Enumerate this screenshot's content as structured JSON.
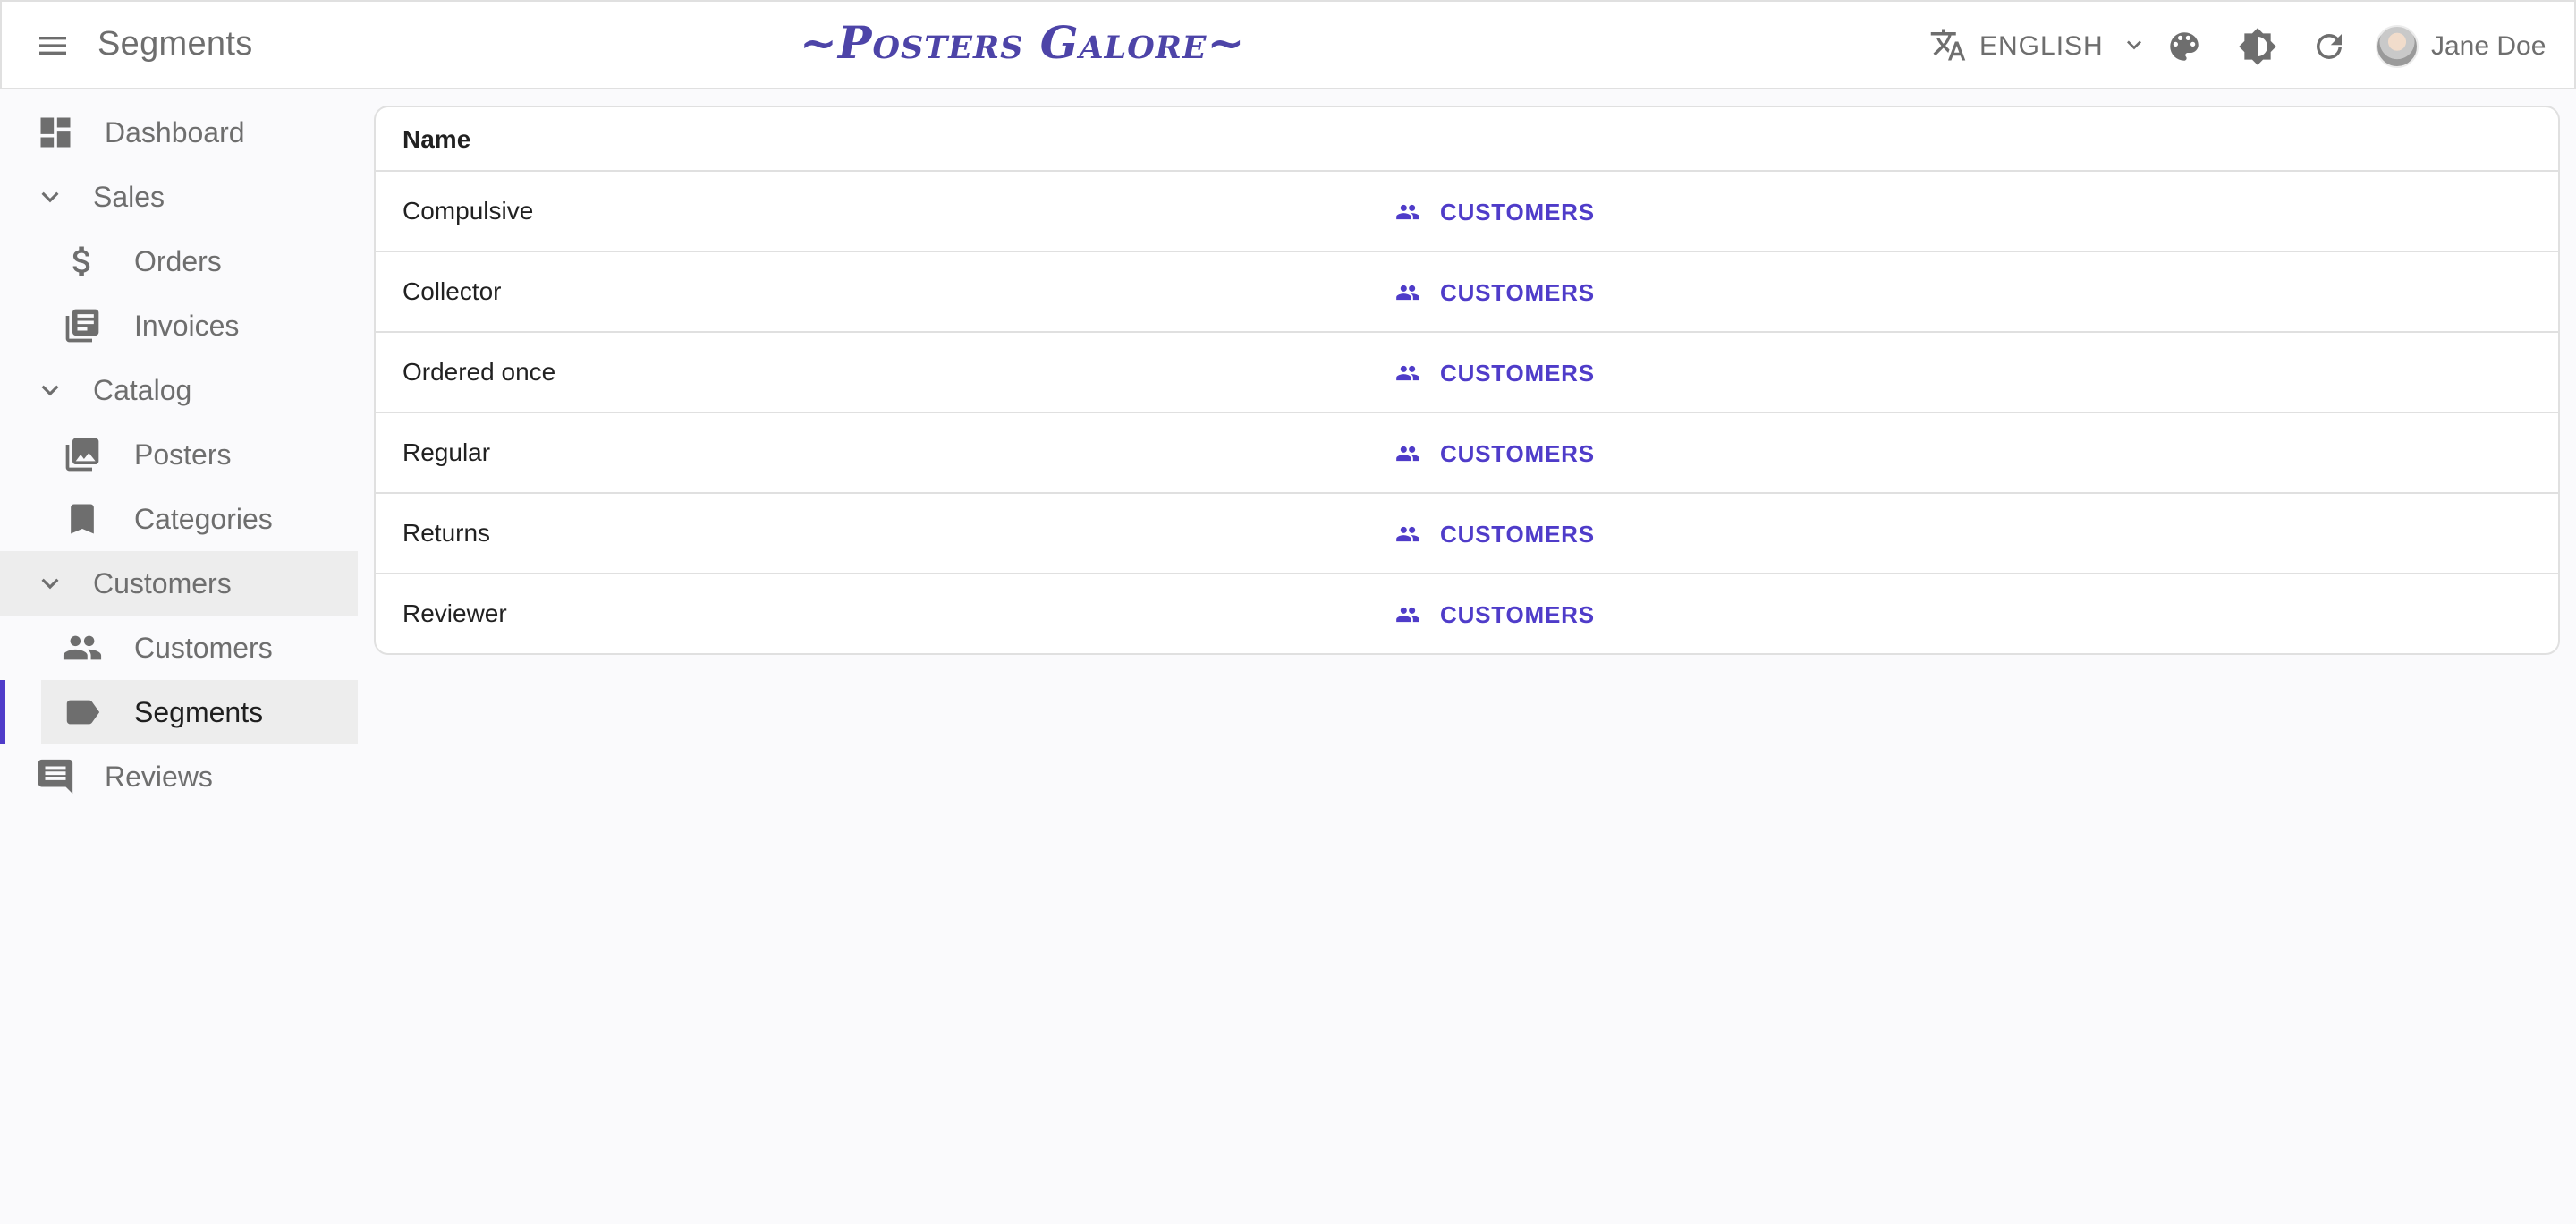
{
  "appbar": {
    "title": "Segments",
    "logo_text": "~Posters Galore~",
    "language": "ENGLISH",
    "user_name": "Jane Doe"
  },
  "sidebar": {
    "items": [
      {
        "label": "Dashboard",
        "icon": "dashboard-icon"
      },
      {
        "label": "Sales",
        "icon": "chevron-down-icon"
      },
      {
        "label": "Orders",
        "icon": "dollar-icon"
      },
      {
        "label": "Invoices",
        "icon": "library-books-icon"
      },
      {
        "label": "Catalog",
        "icon": "chevron-down-icon"
      },
      {
        "label": "Posters",
        "icon": "collections-icon"
      },
      {
        "label": "Categories",
        "icon": "bookmark-icon"
      },
      {
        "label": "Customers",
        "icon": "chevron-down-icon"
      },
      {
        "label": "Customers",
        "icon": "people-icon"
      },
      {
        "label": "Segments",
        "icon": "label-icon"
      },
      {
        "label": "Reviews",
        "icon": "comment-icon"
      }
    ]
  },
  "table": {
    "header": {
      "name": "Name"
    },
    "rows": [
      {
        "name": "Compulsive",
        "link": "CUSTOMERS"
      },
      {
        "name": "Collector",
        "link": "CUSTOMERS"
      },
      {
        "name": "Ordered once",
        "link": "CUSTOMERS"
      },
      {
        "name": "Regular",
        "link": "CUSTOMERS"
      },
      {
        "name": "Returns",
        "link": "CUSTOMERS"
      },
      {
        "name": "Reviewer",
        "link": "CUSTOMERS"
      }
    ]
  },
  "colors": {
    "accent": "#4f3cc9",
    "logo": "#4d44a8",
    "icon_gray": "#6e6e6e",
    "selected_bg": "#ededed"
  }
}
